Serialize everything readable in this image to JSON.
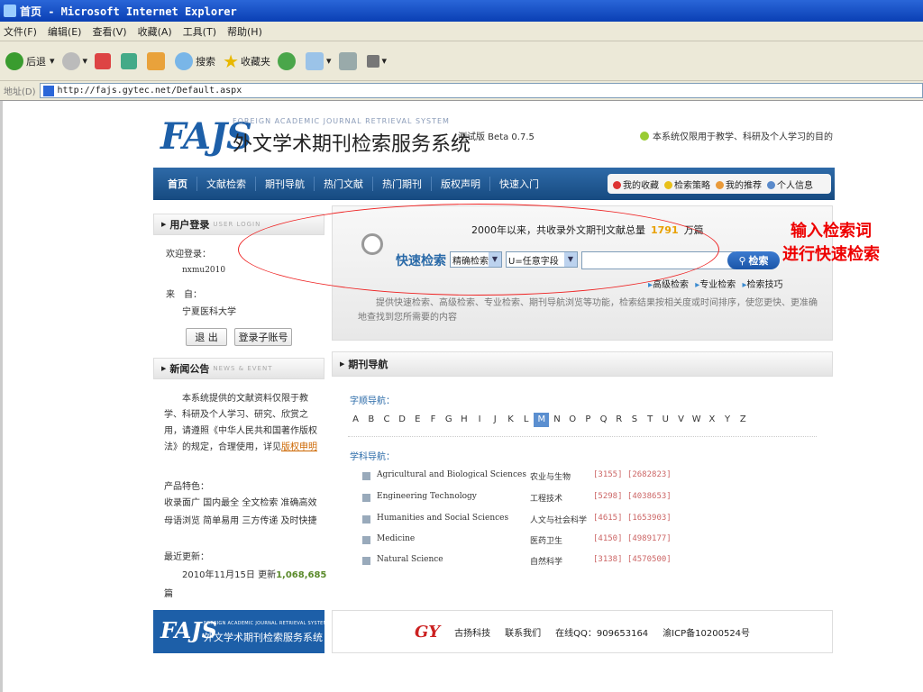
{
  "window": {
    "title": "首页 - Microsoft Internet Explorer"
  },
  "menu": [
    "文件(F)",
    "编辑(E)",
    "查看(V)",
    "收藏(A)",
    "工具(T)",
    "帮助(H)"
  ],
  "toolbar": {
    "back": "后退",
    "search": "搜索",
    "favorites": "收藏夹"
  },
  "address": {
    "label": "地址(D)",
    "url": "http://fajs.gytec.net/Default.aspx"
  },
  "header": {
    "logo": "FAJS",
    "subtitle_en": "FOREIGN ACADEMIC JOURNAL RETRIEVAL SYSTEM",
    "title_cn": "外文学术期刊检索服务系统",
    "beta": "测试版 Beta 0.7.5",
    "notice": "本系统仅限用于教学、科研及个人学习的目的"
  },
  "nav": {
    "items": [
      "首页",
      "文献检索",
      "期刊导航",
      "热门文献",
      "热门期刊",
      "版权声明",
      "快速入门"
    ],
    "right": [
      "我的收藏",
      "检索策略",
      "我的推荐",
      "个人信息"
    ]
  },
  "login": {
    "title": "用户登录",
    "title_en": "USER LOGIN",
    "welcome_label": "欢迎登录：",
    "username": "nxmu2010",
    "from_label": "来　自：",
    "org": "宁夏医科大学",
    "logout": "退 出",
    "sub_account": "登录子账号"
  },
  "news": {
    "title": "新闻公告",
    "title_en": "NEWS & EVENT",
    "body": "本系统提供的文献资料仅限于教学、科研及个人学习、研究、欣赏之用，请遵照《中华人民共和国著作版权法》的规定，合理使用，详见",
    "link": "版权申明",
    "features_label": "产品特色：",
    "features": "收录面广 国内最全 全文检索 准确高效 母语浏览 简单易用 三方传递 及时快捷",
    "update_label": "最近更新：",
    "update_text": "2010年11月15日 更新",
    "update_count": "1,068,685",
    "update_unit": "篇"
  },
  "search": {
    "stats_prefix": "2000年以来，共收录外文期刊文献总量",
    "stats_count": "1791",
    "stats_unit": "万篇",
    "label": "快速检索",
    "mode": "精确检索",
    "field": "U=任意字段",
    "button": "检索",
    "links": [
      "高级检索",
      "专业检索",
      "检索技巧"
    ],
    "desc": "提供快速检索、高级检索、专业检索、期刊导航浏览等功能，检索结果按相关度或时间排序，使您更快、更准确地查找到您所需要的内容"
  },
  "journal": {
    "title": "期刊导航",
    "alpha_label": "字顺导航：",
    "letters": [
      "A",
      "B",
      "C",
      "D",
      "E",
      "F",
      "G",
      "H",
      "I",
      "J",
      "K",
      "L",
      "M",
      "N",
      "O",
      "P",
      "Q",
      "R",
      "S",
      "T",
      "U",
      "V",
      "W",
      "X",
      "Y",
      "Z"
    ],
    "selected": "M",
    "subject_label": "学科导航：",
    "subjects": [
      {
        "en": "Agricultural and Biological Sciences",
        "cn": "农业与生物",
        "counts": "[3155] [2682823]"
      },
      {
        "en": "Engineering Technology",
        "cn": "工程技术",
        "counts": "[5298] [4038653]"
      },
      {
        "en": "Humanities and Social Sciences",
        "cn": "人文与社会科学",
        "counts": "[4615] [1653903]"
      },
      {
        "en": "Medicine",
        "cn": "医药卫生",
        "counts": "[4150] [4989177]"
      },
      {
        "en": "Natural Science",
        "cn": "自然科学",
        "counts": "[3138] [4570500]"
      }
    ]
  },
  "footer": {
    "logo": "FAJS",
    "logo_en": "FOREIGN ACADEMIC JOURNAL RETRIEVAL SYSTEM",
    "logo_cn": "外文学术期刊检索服务系统",
    "brand": "GY",
    "company": "古扬科技",
    "contact": "联系我们",
    "qq": "在线QQ：909653164",
    "icp": "渝ICP备10200524号"
  },
  "annotation": {
    "line1": "输入检索词",
    "line2": "进行快速检索"
  }
}
